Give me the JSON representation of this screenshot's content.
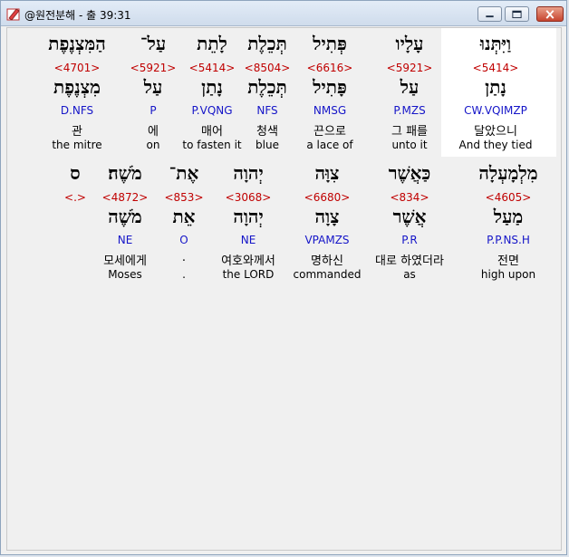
{
  "window": {
    "title": "@원전분해 - 출 39:31",
    "icon": "pencil-app-icon",
    "buttons": [
      "minimize",
      "maximize",
      "close"
    ]
  },
  "colors": {
    "strong": "#c00000",
    "morph": "#1515c8",
    "highlight": "#ffffff"
  },
  "row1": [
    {
      "heb": "וַיִּתְּנוּ",
      "strong": "<5414>",
      "root": "נָתַן",
      "morph": "CW.VQIMZP",
      "kor": "달았으니",
      "eng": "And they tied",
      "selected": true
    },
    {
      "heb": "עָלָיו",
      "strong": "<5921>",
      "root": "עַל",
      "morph": "P.MZS",
      "kor": "그 패를",
      "eng": "unto it"
    },
    {
      "heb": "פְּתִיל",
      "strong": "<6616>",
      "root": "פָּתִיל",
      "morph": "NMSG",
      "kor": "끈으로",
      "eng": "a lace of"
    },
    {
      "heb": "תְּכֵלֶת",
      "strong": "<8504>",
      "root": "תְּכֵלֶת",
      "morph": "NFS",
      "kor": "청색",
      "eng": "blue"
    },
    {
      "heb": "לָתֵת",
      "strong": "<5414>",
      "root": "נָתַן",
      "morph": "P.VQNG",
      "kor": "매어",
      "eng": "to fasten it"
    },
    {
      "heb": "עַל־",
      "strong": "<5921>",
      "root": "עַל",
      "morph": "P",
      "kor": "에",
      "eng": "on"
    },
    {
      "heb": "הַמִּצְנֶפֶת",
      "strong": "<4701>",
      "root": "מִצְנֶפֶת",
      "morph": "D.NFS",
      "kor": "관",
      "eng": "the mitre"
    }
  ],
  "row2": [
    {
      "heb": "מִלְמָעְלָה",
      "strong": "<4605>",
      "root": "מַעַל",
      "morph": "P.P.NS.H",
      "kor": "전면",
      "eng": "high upon"
    },
    {
      "heb": "כַּאֲשֶׁר",
      "strong": "<834>",
      "root": "אֲשֶׁר",
      "morph": "P.R",
      "kor": "대로 하였더라",
      "eng": "as"
    },
    {
      "heb": "צִוָּה",
      "strong": "<6680>",
      "root": "צָוָה",
      "morph": "VPAMZS",
      "kor": "명하신",
      "eng": "commanded"
    },
    {
      "heb": "יְהוָה",
      "strong": "<3068>",
      "root": "יְהוָה",
      "morph": "NE",
      "kor": "여호와께서",
      "eng": "the LORD"
    },
    {
      "heb": "אֶת־",
      "strong": "<853>",
      "root": "אֵת",
      "morph": "O",
      "kor": ".",
      "eng": "."
    },
    {
      "heb": "מֹשֶׁה׃",
      "strong": "<4872>",
      "root": "מֹשֶׁה",
      "morph": "NE",
      "kor": "모세에게",
      "eng": "Moses"
    },
    {
      "heb": "ס",
      "strong": "<.>",
      "root": "",
      "morph": "",
      "kor": "",
      "eng": ""
    }
  ]
}
